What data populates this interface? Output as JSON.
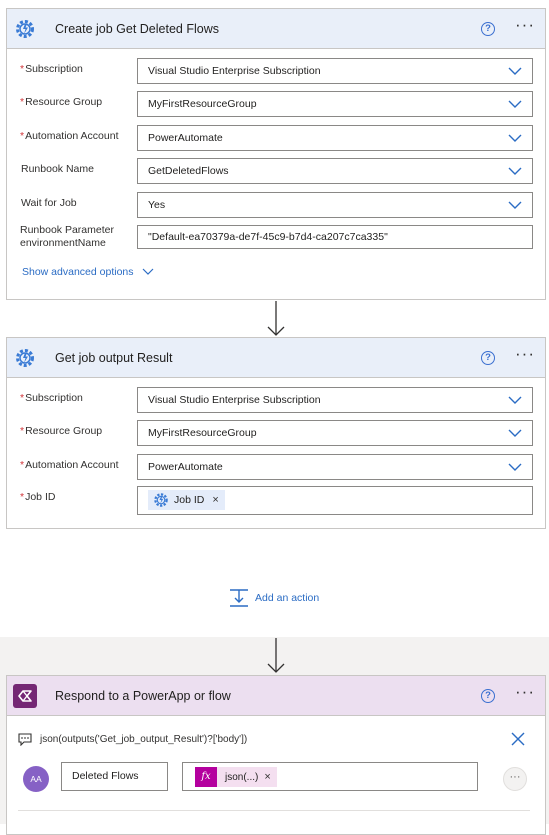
{
  "card1": {
    "title": "Create job Get Deleted Flows",
    "help_icon": "?",
    "more_icon": "···",
    "fields": [
      {
        "label": "Subscription",
        "required": "*",
        "value": "Visual Studio Enterprise Subscription"
      },
      {
        "label": "Resource Group",
        "required": "*",
        "value": "MyFirstResourceGroup"
      },
      {
        "label": "Automation Account",
        "required": "*",
        "value": "PowerAutomate"
      },
      {
        "label": "Runbook Name",
        "required": "",
        "value": "GetDeletedFlows"
      },
      {
        "label": "Wait for Job",
        "required": "",
        "value": "Yes"
      }
    ],
    "param": {
      "label_line1": "Runbook Parameter",
      "label_line2": "environmentName",
      "value": "\"Default-ea70379a-de7f-45c9-b7d4-ca207c7ca335\""
    },
    "advanced_options": "Show advanced options"
  },
  "card2": {
    "title": "Get job output Result",
    "help_icon": "?",
    "more_icon": "···",
    "fields": [
      {
        "label": "Subscription",
        "required": "*",
        "value": "Visual Studio Enterprise Subscription"
      },
      {
        "label": "Resource Group",
        "required": "*",
        "value": "MyFirstResourceGroup"
      },
      {
        "label": "Automation Account",
        "required": "*",
        "value": "PowerAutomate"
      }
    ],
    "job_id": {
      "label": "Job ID",
      "required": "*",
      "token": "Job ID",
      "token_remove": "×"
    }
  },
  "add_action": {
    "label": "Add an action"
  },
  "card3": {
    "title": "Respond to a PowerApp or flow",
    "help_icon": "?",
    "more_icon": "···",
    "expression": "json(outputs('Get_job_output_Result')?['body'])",
    "avatar_text": "AA",
    "output_name": "Deleted Flows",
    "fx_label": "fx",
    "fx_token": "json(...)",
    "fx_remove": "×",
    "ellipsis": "···"
  },
  "colors": {
    "accent": "#2b6cc4",
    "header_blue": "#e9eff9",
    "header_purple": "#ecdff0",
    "required": "#d13438",
    "powerapps": "#742774",
    "expression": "#b4009e"
  },
  "icons": {
    "automation": "automation-gear-icon",
    "powerapps": "powerapps-icon",
    "chevron": "chevron-down-icon",
    "comment": "comment-icon",
    "close": "close-icon",
    "add": "add-action-icon",
    "arrow": "arrow-down-icon"
  }
}
